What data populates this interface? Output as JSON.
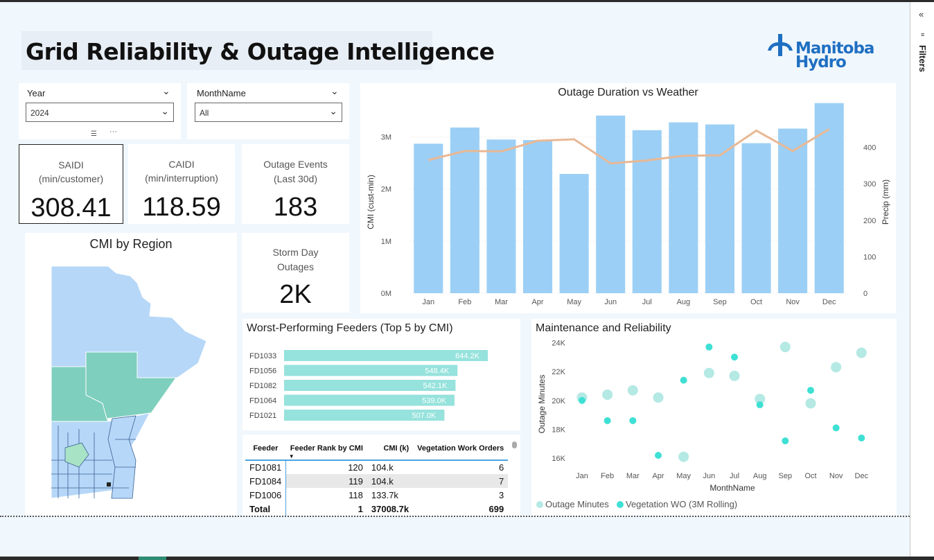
{
  "header": {
    "title": "Grid Reliability & Outage Intelligence",
    "logo_line1": "Manitoba",
    "logo_line2": "Hydro"
  },
  "filters_pane": {
    "label": "Filters"
  },
  "slicers": {
    "year": {
      "label": "Year",
      "value": "2024"
    },
    "month": {
      "label": "MonthName",
      "value": "All"
    }
  },
  "kpis": {
    "saidi": {
      "label1": "SAIDI",
      "label2": "(min/customer)",
      "value": "308.41"
    },
    "caidi": {
      "label1": "CAIDI",
      "label2": "(min/interruption)",
      "value": "118.59"
    },
    "events": {
      "label1": "Outage Events",
      "label2": "(Last 30d)",
      "value": "183"
    },
    "storm": {
      "label1": "Storm Day",
      "label2": "Outages",
      "value": "2K"
    }
  },
  "map": {
    "title": "CMI by Region"
  },
  "chart_data": [
    {
      "type": "bar",
      "title": "Outage Duration vs Weather",
      "ylabel": "CMI (cust-min)",
      "y2label": "Precip (mm)",
      "categories": [
        "Jan",
        "Feb",
        "Mar",
        "Apr",
        "May",
        "Jun",
        "Jul",
        "Aug",
        "Sep",
        "Oct",
        "Nov",
        "Dec"
      ],
      "ylim": [
        0,
        3500000
      ],
      "yticks": [
        "0M",
        "1M",
        "2M",
        "3M"
      ],
      "y2lim": [
        0,
        500
      ],
      "y2ticks": [
        "0",
        "100",
        "200",
        "300",
        "400"
      ],
      "series": [
        {
          "type": "bar",
          "values": [
            2870000,
            3180000,
            2950000,
            2940000,
            2290000,
            3410000,
            3130000,
            3280000,
            3240000,
            2880000,
            3160000,
            3650000
          ],
          "color": "#9ccff5"
        },
        {
          "type": "line",
          "axis": "secondary",
          "values": [
            365,
            390,
            389,
            418,
            422,
            356,
            364,
            377,
            378,
            446,
            390,
            450
          ],
          "color": "#e8b894"
        }
      ]
    },
    {
      "type": "bar",
      "orientation": "horizontal",
      "title": "Worst-Performing Feeders (Top 5 by CMI)",
      "categories": [
        "FD1033",
        "FD1056",
        "FD1082",
        "FD1064",
        "FD1021"
      ],
      "values": [
        644.2,
        548.4,
        542.1,
        539.0,
        507.0
      ],
      "data_labels": [
        "644.2K",
        "548.4K",
        "542.1K",
        "539.0K",
        "507.0K"
      ],
      "color": "#96e2dc"
    },
    {
      "type": "scatter",
      "title": "Maintenance and Reliability",
      "xlabel": "MonthName",
      "ylabel": "Outage Minutes",
      "categories": [
        "Jan",
        "Feb",
        "Mar",
        "Apr",
        "May",
        "Jun",
        "Jul",
        "Aug",
        "Sep",
        "Oct",
        "Nov",
        "Dec"
      ],
      "ylim": [
        15000,
        24500
      ],
      "yticks": [
        "16K",
        "18K",
        "20K",
        "22K",
        "24K"
      ],
      "legend_placement": "bottom-left",
      "series": [
        {
          "name": "Outage Minutes",
          "color": "#b4e9e4",
          "values": [
            20200,
            20400,
            20700,
            20200,
            16100,
            21900,
            21700,
            20100,
            23700,
            19800,
            22300,
            23300
          ]
        },
        {
          "name": "Vegetation WO (3M Rolling)",
          "color": "#3fe0d4",
          "values": [
            20000,
            18600,
            18600,
            16200,
            21400,
            23700,
            23000,
            19700,
            17200,
            20700,
            18100,
            17400
          ]
        }
      ]
    }
  ],
  "table": {
    "headers": [
      "Feeder",
      "Feeder Rank by CMI",
      "CMI (k)",
      "Vegetation Work Orders"
    ],
    "rows": [
      [
        "FD1081",
        "120",
        "104.k",
        "6"
      ],
      [
        "FD1084",
        "119",
        "104.k",
        "7"
      ],
      [
        "FD1006",
        "118",
        "133.7k",
        "3"
      ]
    ],
    "total": [
      "Total",
      "1",
      "37008.7k",
      "699"
    ]
  }
}
